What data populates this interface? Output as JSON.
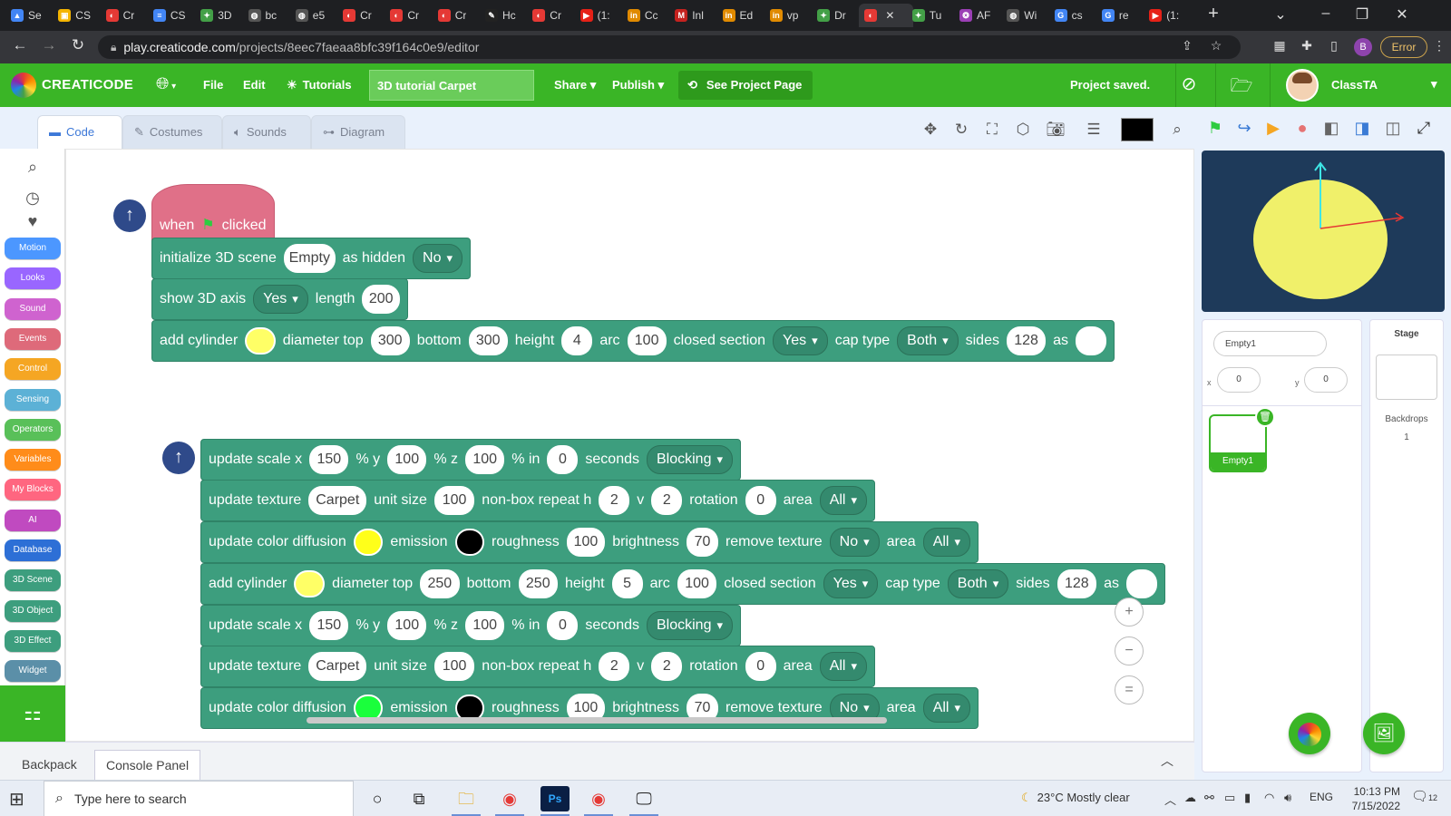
{
  "browser": {
    "tabs": [
      {
        "title": "Se",
        "color": "#4285f4",
        "glyph": "▲"
      },
      {
        "title": "CS",
        "color": "#f4b400",
        "glyph": "▣"
      },
      {
        "title": "Cr",
        "color": "#e53935",
        "glyph": "◐"
      },
      {
        "title": "CS",
        "color": "#4285f4",
        "glyph": "≡"
      },
      {
        "title": "3D",
        "color": "#43a047",
        "glyph": "✦"
      },
      {
        "title": "bc",
        "color": "#555555",
        "glyph": "◍"
      },
      {
        "title": "e5",
        "color": "#555555",
        "glyph": "◍"
      },
      {
        "title": "Cr",
        "color": "#e53935",
        "glyph": "◐"
      },
      {
        "title": "Cr",
        "color": "#e53935",
        "glyph": "◐"
      },
      {
        "title": "Cr",
        "color": "#e53935",
        "glyph": "◐"
      },
      {
        "title": "Hc",
        "color": "#222222",
        "glyph": "✎"
      },
      {
        "title": "Cr",
        "color": "#e53935",
        "glyph": "◐"
      },
      {
        "title": "(1:",
        "color": "#e62117",
        "glyph": "▶"
      },
      {
        "title": "Cc",
        "color": "#e08a00",
        "glyph": "in"
      },
      {
        "title": "Inl",
        "color": "#c5221f",
        "glyph": "M"
      },
      {
        "title": "Ed",
        "color": "#e08a00",
        "glyph": "in"
      },
      {
        "title": "vp",
        "color": "#e08a00",
        "glyph": "in"
      },
      {
        "title": "Dr",
        "color": "#43a047",
        "glyph": "✦"
      },
      {
        "title": "",
        "color": "#e53935",
        "glyph": "◐"
      },
      {
        "title": "Tu",
        "color": "#43a047",
        "glyph": "✦"
      },
      {
        "title": "AF",
        "color": "#9b3fb5",
        "glyph": "❂"
      },
      {
        "title": "Wi",
        "color": "#555555",
        "glyph": "◍"
      },
      {
        "title": "cs",
        "color": "#4285f4",
        "glyph": "G"
      },
      {
        "title": "re",
        "color": "#4285f4",
        "glyph": "G"
      },
      {
        "title": "(1:",
        "color": "#e62117",
        "glyph": "▶"
      }
    ],
    "active_tab_index": 18,
    "new_tab": "+",
    "url_host": "play.creaticode.com",
    "url_path": "/projects/8eec7faeaa8bfc39f164c0e9/editor",
    "profile_initial": "B",
    "error_label": "Error"
  },
  "app": {
    "logo": "CREATICODE",
    "menu_file": "File",
    "menu_edit": "Edit",
    "menu_tutorials": "Tutorials",
    "project_title": "3D tutorial Carpet",
    "menu_share": "Share",
    "menu_publish": "Publish",
    "see_project": "See Project Page",
    "status": "Project saved.",
    "user": "ClassTA"
  },
  "editor_tabs": {
    "code": "Code",
    "costumes": "Costumes",
    "sounds": "Sounds",
    "diagram": "Diagram"
  },
  "categories": [
    {
      "label": "Motion",
      "color": "#4c97ff"
    },
    {
      "label": "Looks",
      "color": "#9966ff"
    },
    {
      "label": "Sound",
      "color": "#cf63cf"
    },
    {
      "label": "Events",
      "color": "#de6a7a"
    },
    {
      "label": "Control",
      "color": "#f5a623"
    },
    {
      "label": "Sensing",
      "color": "#5cb1d6"
    },
    {
      "label": "Operators",
      "color": "#59c059"
    },
    {
      "label": "Variables",
      "color": "#ff8c1a"
    },
    {
      "label": "My Blocks",
      "color": "#ff6680"
    },
    {
      "label": "AI",
      "color": "#c04ac0"
    },
    {
      "label": "Database",
      "color": "#2d6fd6"
    },
    {
      "label": "3D Scene",
      "color": "#3d9e7e"
    },
    {
      "label": "3D Object",
      "color": "#3d9e7e"
    },
    {
      "label": "3D Effect",
      "color": "#3d9e7e"
    },
    {
      "label": "Widget",
      "color": "#5b8fa8"
    }
  ],
  "script1": {
    "hat": {
      "when": "when",
      "clicked": "clicked"
    },
    "init": {
      "t1": "initialize 3D scene",
      "scene": "Empty",
      "t2": "as hidden",
      "hidden": "No"
    },
    "axis": {
      "t1": "show 3D axis",
      "show": "Yes",
      "t2": "length",
      "length": "200"
    },
    "cyl": {
      "t1": "add cylinder",
      "color": "#ffff66",
      "t2": "diameter top",
      "top": "300",
      "t3": "bottom",
      "bottom": "300",
      "t4": "height",
      "height": "4",
      "t5": "arc",
      "arc": "100",
      "t6": "closed section",
      "closed": "Yes",
      "t7": "cap type",
      "cap": "Both",
      "t8": "sides",
      "sides": "128",
      "t9": "as",
      "as": ""
    }
  },
  "script2": {
    "scale1": {
      "t1": "update scale x",
      "x": "150",
      "t2": "% y",
      "y": "100",
      "t3": "% z",
      "z": "100",
      "t4": "% in",
      "secs": "0",
      "t5": "seconds",
      "mode": "Blocking"
    },
    "tex1": {
      "t1": "update texture",
      "tex": "Carpet",
      "t2": "unit size",
      "unit": "100",
      "t3": "non-box repeat h",
      "h": "2",
      "t4": "v",
      "v": "2",
      "t5": "rotation",
      "rot": "0",
      "t6": "area",
      "area": "All"
    },
    "col1": {
      "t1": "update color diffusion",
      "diff": "#ffff1a",
      "t2": "emission",
      "emis": "#000000",
      "t3": "roughness",
      "rough": "100",
      "t4": "brightness",
      "bright": "70",
      "t5": "remove texture",
      "remove": "No",
      "t6": "area",
      "area": "All"
    },
    "cyl2": {
      "t1": "add cylinder",
      "color": "#ffff66",
      "t2": "diameter top",
      "top": "250",
      "t3": "bottom",
      "bottom": "250",
      "t4": "height",
      "height": "5",
      "t5": "arc",
      "arc": "100",
      "t6": "closed section",
      "closed": "Yes",
      "t7": "cap type",
      "cap": "Both",
      "t8": "sides",
      "sides": "128",
      "t9": "as",
      "as": ""
    },
    "scale2": {
      "t1": "update scale x",
      "x": "150",
      "t2": "% y",
      "y": "100",
      "t3": "% z",
      "z": "100",
      "t4": "% in",
      "secs": "0",
      "t5": "seconds",
      "mode": "Blocking"
    },
    "tex2": {
      "t1": "update texture",
      "tex": "Carpet",
      "t2": "unit size",
      "unit": "100",
      "t3": "non-box repeat h",
      "h": "2",
      "t4": "v",
      "v": "2",
      "t5": "rotation",
      "rot": "0",
      "t6": "area",
      "area": "All"
    },
    "col2": {
      "t1": "update color diffusion",
      "diff": "#1aff3c",
      "t2": "emission",
      "emis": "#000000",
      "t3": "roughness",
      "rough": "100",
      "t4": "brightness",
      "bright": "70",
      "t5": "remove texture",
      "remove": "No",
      "t6": "area",
      "area": "All"
    }
  },
  "bottom": {
    "backpack": "Backpack",
    "console": "Console Panel"
  },
  "sprite": {
    "name": "Empty1",
    "x_label": "x",
    "x": "0",
    "y_label": "y",
    "y": "0",
    "card_name": "Empty1"
  },
  "stage_pane": {
    "title": "Stage",
    "backdrops_label": "Backdrops",
    "backdrops_count": "1"
  },
  "taskbar": {
    "search_placeholder": "Type here to search",
    "weather": "23°C  Mostly clear",
    "lang": "ENG",
    "time": "10:13 PM",
    "date": "7/15/2022",
    "notif_count": "12"
  },
  "colors": {
    "brand_green": "#3ab526",
    "block_3d": "#3d9e7e",
    "stage_bg": "#1e3a5a",
    "stage_disc": "#f0f06a"
  }
}
